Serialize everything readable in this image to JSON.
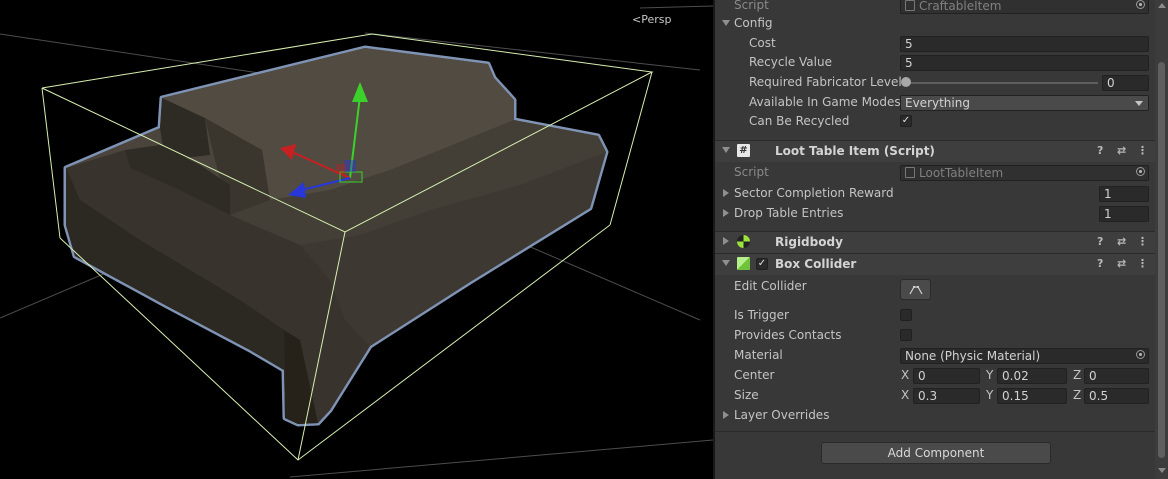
{
  "scene": {
    "camera_label": "Persp",
    "colors": {
      "object_fill": "#4a443c",
      "outline": "#7f93b4",
      "bounds": "#d6f0b0",
      "grid": "#5a5a5a",
      "y_axis": "#3cd12a",
      "x_axis": "#c82020",
      "z_axis": "#2838d8"
    }
  },
  "inspector": {
    "craftable": {
      "script_label": "Script",
      "script_value": "CraftableItem",
      "config_label": "Config",
      "cost_label": "Cost",
      "cost_value": "5",
      "recycle_label": "Recycle Value",
      "recycle_value": "5",
      "fab_label": "Required Fabricator Level",
      "fab_value": "0",
      "modes_label": "Available In Game Modes",
      "modes_value": "Everything",
      "can_recycle_label": "Can Be Recycled",
      "can_recycle_checked": true
    },
    "loot": {
      "title": "Loot Table Item (Script)",
      "script_label": "Script",
      "script_value": "LootTableItem",
      "sector_label": "Sector Completion Reward",
      "sector_value": "1",
      "drop_label": "Drop Table Entries",
      "drop_value": "1"
    },
    "rigidbody": {
      "title": "Rigidbody"
    },
    "box_collider": {
      "title": "Box Collider",
      "enabled": true,
      "edit_label": "Edit Collider",
      "trigger_label": "Is Trigger",
      "contacts_label": "Provides Contacts",
      "material_label": "Material",
      "material_value": "None (Physic Material)",
      "center_label": "Center",
      "center": {
        "x": "0",
        "y": "0.02",
        "z": "0"
      },
      "size_label": "Size",
      "size": {
        "x": "0.3",
        "y": "0.15",
        "z": "0.5"
      },
      "axis_x": "X",
      "axis_y": "Y",
      "axis_z": "Z",
      "layer_label": "Layer Overrides"
    },
    "add_component_label": "Add Component",
    "header_icons": {
      "help": "?",
      "presets": "⇄",
      "menu": "⋮"
    },
    "icon_glyphs": {
      "script": "#",
      "check": "✓"
    }
  }
}
